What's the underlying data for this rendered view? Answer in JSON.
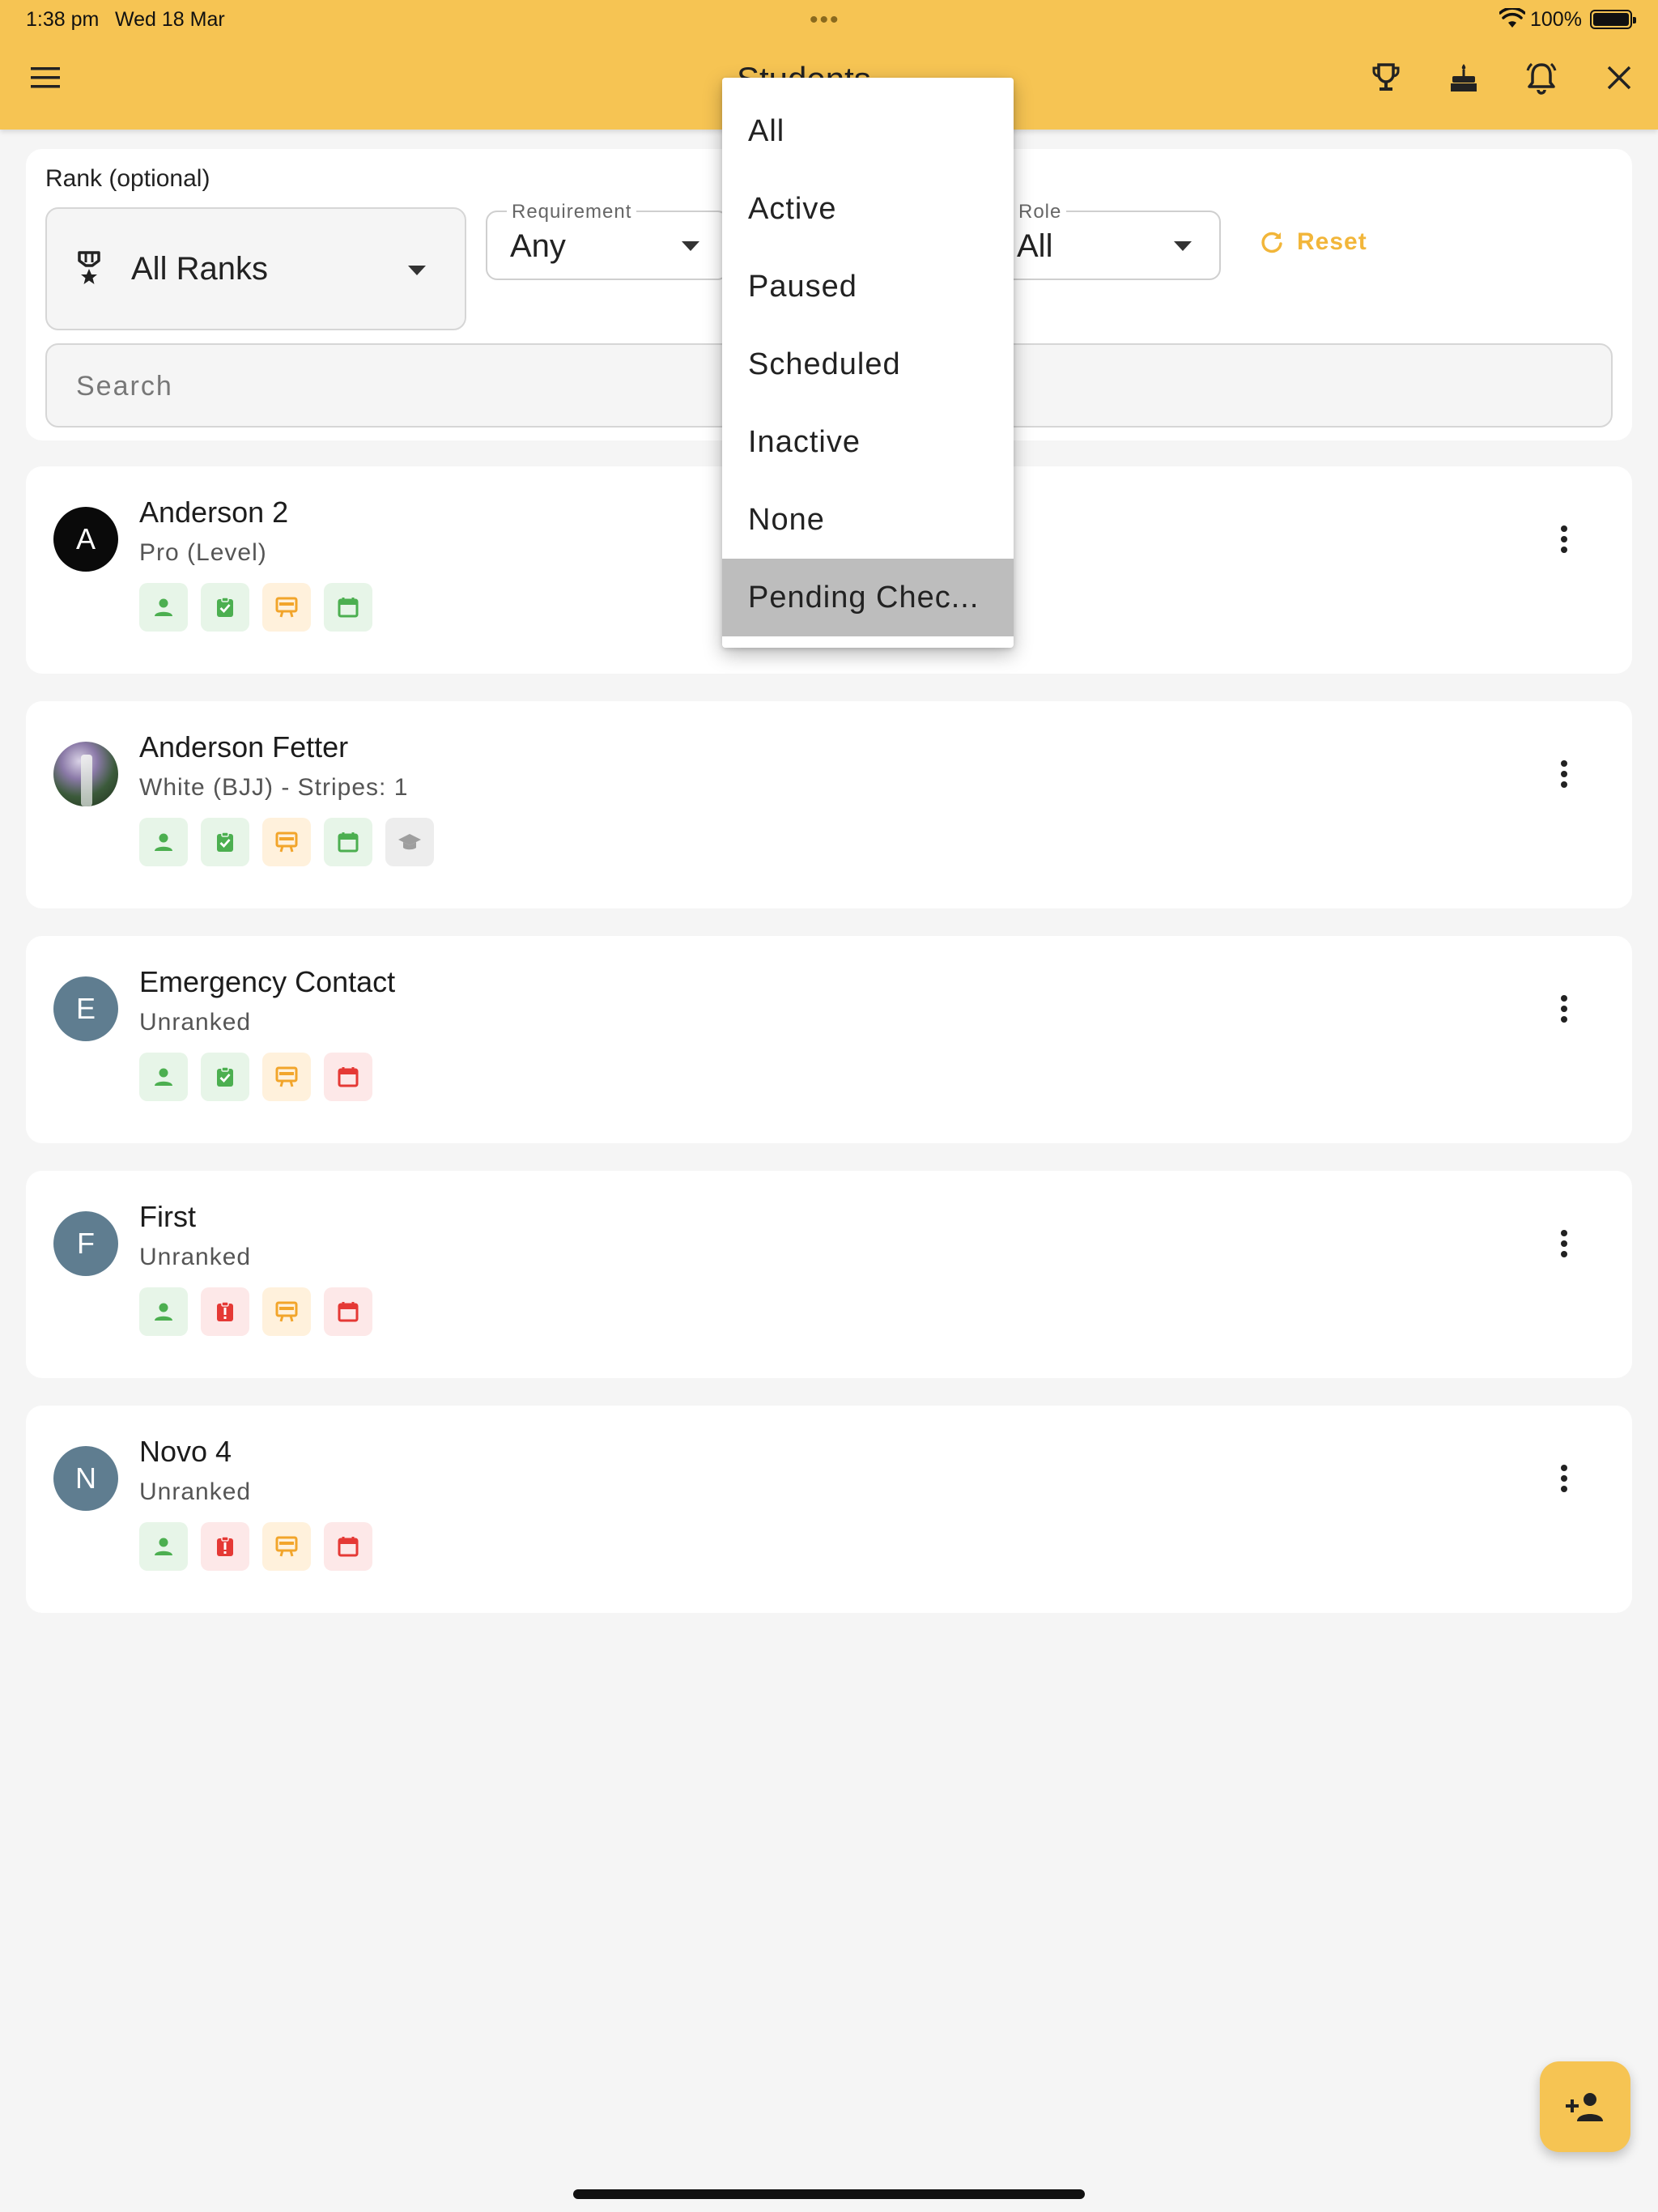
{
  "status_bar": {
    "time": "1:38 pm",
    "date": "Wed 18 Mar",
    "dots": "•••",
    "battery": "100%"
  },
  "header": {
    "title": "Students",
    "icons": [
      "menu-icon",
      "trophy-icon",
      "cake-icon",
      "alarm-bell-icon",
      "close-icon"
    ],
    "color": "#f6c453"
  },
  "filters": {
    "rank_label": "Rank (optional)",
    "rank_value": "All Ranks",
    "requirement_label": "Requirement",
    "requirement_value": "Any",
    "role_label": "Role",
    "role_value": "All",
    "reset_label": "Reset",
    "search_placeholder": "Search"
  },
  "status_dropdown": {
    "options": [
      "All",
      "Active",
      "Paused",
      "Scheduled",
      "Inactive",
      "None",
      "Pending Chec..."
    ],
    "highlighted": "Pending Chec..."
  },
  "students": [
    {
      "initial": "A",
      "name": "Anderson 2",
      "rank": "Pro (Level)",
      "badges": [
        "person-green",
        "check-green",
        "board-amber",
        "calendar-green"
      ]
    },
    {
      "initial": "",
      "name": "Anderson Fetter",
      "rank": "White (BJJ) - Stripes: 1",
      "badges": [
        "person-green",
        "check-green",
        "board-amber",
        "calendar-green",
        "graduation-grey"
      ]
    },
    {
      "initial": "E",
      "name": "Emergency Contact",
      "rank": "Unranked",
      "badges": [
        "person-green",
        "check-green",
        "board-amber",
        "calendar-red"
      ]
    },
    {
      "initial": "F",
      "name": "First",
      "rank": "Unranked",
      "badges": [
        "person-green",
        "alert-red",
        "board-amber",
        "calendar-red"
      ]
    },
    {
      "initial": "N",
      "name": "Novo 4",
      "rank": "Unranked",
      "badges": [
        "person-green",
        "alert-red",
        "board-amber",
        "calendar-red"
      ]
    }
  ],
  "fab": {
    "icon": "add-person-icon"
  }
}
